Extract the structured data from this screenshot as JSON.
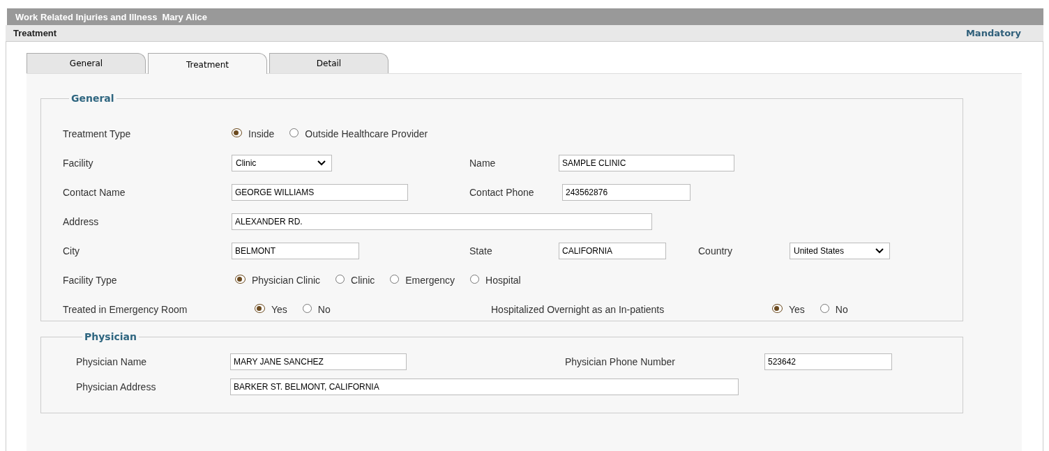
{
  "header": {
    "title": "Work Related Injuries and Illness",
    "employee": "Mary Alice"
  },
  "subheader": {
    "title": "Treatment",
    "mandatory": "Mandatory"
  },
  "tabs": [
    {
      "label": "General",
      "selected": false
    },
    {
      "label": "Treatment",
      "selected": true
    },
    {
      "label": "Detail",
      "selected": false
    }
  ],
  "general": {
    "legend": "General",
    "treatment_type": {
      "label": "Treatment Type",
      "options": [
        {
          "label": "Inside",
          "selected": true
        },
        {
          "label": "Outside Healthcare Provider",
          "selected": false
        }
      ]
    },
    "facility": {
      "label": "Facility",
      "value": "Clinic"
    },
    "name": {
      "label": "Name",
      "value": "SAMPLE CLINIC"
    },
    "contact_name": {
      "label": "Contact Name",
      "value": "GEORGE WILLIAMS"
    },
    "contact_phone": {
      "label": "Contact Phone",
      "value": "243562876"
    },
    "address": {
      "label": "Address",
      "value": "ALEXANDER RD."
    },
    "city": {
      "label": "City",
      "value": "BELMONT"
    },
    "state": {
      "label": "State",
      "value": "CALIFORNIA"
    },
    "country": {
      "label": "Country",
      "value": "United States"
    },
    "facility_type": {
      "label": "Facility Type",
      "options": [
        {
          "label": "Physician Clinic",
          "selected": true
        },
        {
          "label": "Clinic",
          "selected": false
        },
        {
          "label": "Emergency",
          "selected": false
        },
        {
          "label": "Hospital",
          "selected": false
        }
      ]
    },
    "treated_in_er": {
      "label": "Treated in Emergency Room",
      "options": [
        {
          "label": "Yes",
          "selected": true
        },
        {
          "label": "No",
          "selected": false
        }
      ]
    },
    "hospitalized_overnight": {
      "label": "Hospitalized Overnight as an In-patients",
      "options": [
        {
          "label": "Yes",
          "selected": true
        },
        {
          "label": "No",
          "selected": false
        }
      ]
    }
  },
  "physician": {
    "legend": "Physician",
    "name": {
      "label": "Physician Name",
      "value": "MARY JANE SANCHEZ"
    },
    "phone": {
      "label": "Physician Phone Number",
      "value": "523642"
    },
    "address": {
      "label": "Physician Address",
      "value": "BARKER ST. BELMONT, CALIFORNIA"
    }
  }
}
